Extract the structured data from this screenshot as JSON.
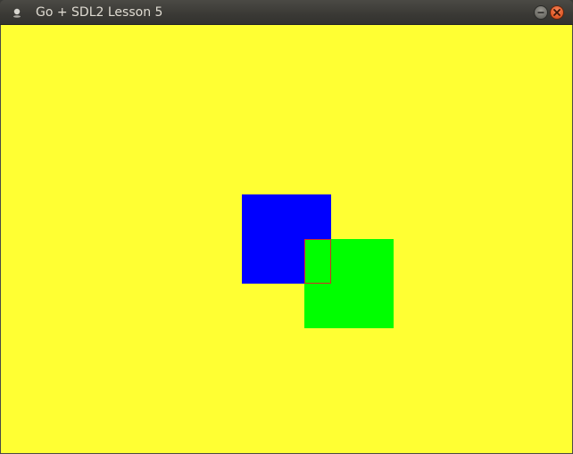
{
  "window": {
    "title": "Go + SDL2 Lesson 5",
    "icon": "app-icon",
    "controls": [
      {
        "name": "minimize-button",
        "icon": "minimize-icon"
      },
      {
        "name": "close-button",
        "icon": "close-icon"
      }
    ]
  },
  "canvas": {
    "background_color": "#ffff33",
    "shapes": [
      {
        "name": "blue-rectangle",
        "color": "#0000ff"
      },
      {
        "name": "green-rectangle",
        "color": "#00ff00"
      },
      {
        "name": "overlap-rectangle-outline",
        "color": "#d62a2a"
      }
    ]
  }
}
